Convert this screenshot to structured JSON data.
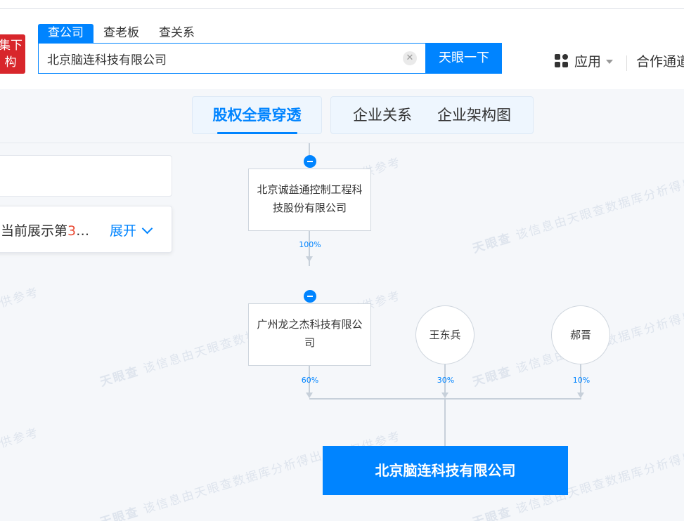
{
  "header": {
    "logo_line1": "集下",
    "logo_line2": "构",
    "search_tabs": [
      "查公司",
      "查老板",
      "查关系"
    ],
    "search_value": "北京脑连科技有限公司",
    "search_button": "天眼一下",
    "apps_label": "应用",
    "partner_label": "合作通道"
  },
  "view_tabs": {
    "active": "股权全景穿透",
    "others": [
      "企业关系",
      "企业架构图"
    ]
  },
  "side_panel": {
    "info_prefix": "当前展示第",
    "info_highlight": "3",
    "info_suffix": "…",
    "expand_label": "展开"
  },
  "watermark": {
    "brand": "天眼查",
    "text": "该信息由天眼查数据库分析得出",
    "ref": "仅供参考"
  },
  "graph": {
    "node1": "北京诚益通控制工程科技股份有限公司",
    "node1_pct": "100%",
    "node2": "广州龙之杰科技有限公司",
    "node2_pct": "60%",
    "person1": "王东兵",
    "person1_pct": "30%",
    "person2": "郝晋",
    "person2_pct": "10%",
    "target": "北京脑连科技有限公司"
  },
  "colors": {
    "accent": "#0084ff",
    "logo": "#d8262b",
    "highlight": "#e94b35"
  }
}
